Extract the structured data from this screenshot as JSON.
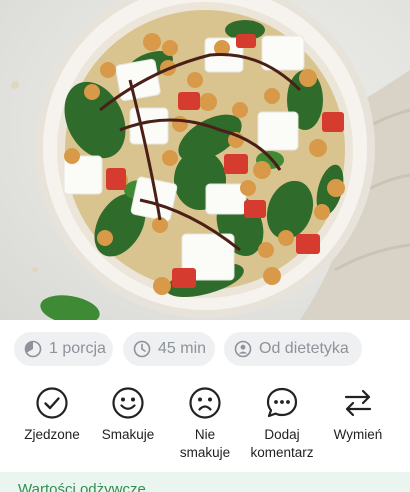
{
  "meta_chips": [
    {
      "icon": "pie-clock-icon",
      "label": "1 porcja"
    },
    {
      "icon": "clock-icon",
      "label": "45 min"
    },
    {
      "icon": "user-badge-icon",
      "label": "Od dietetyka"
    }
  ],
  "actions": [
    {
      "icon": "checkmark-circle-icon",
      "label_line1": "Zjedzone",
      "label_line2": ""
    },
    {
      "icon": "smile-face-icon",
      "label_line1": "Smakuje",
      "label_line2": ""
    },
    {
      "icon": "sad-face-icon",
      "label_line1": "Nie",
      "label_line2": "smakuje"
    },
    {
      "icon": "comment-icon",
      "label_line1": "Dodaj",
      "label_line2": "komentarz"
    },
    {
      "icon": "swap-arrows-icon",
      "label_line1": "Wymień",
      "label_line2": ""
    }
  ],
  "footer": {
    "title": "Wartości odżywcze"
  },
  "colors": {
    "accent_green": "#2f8f55",
    "chip_bg": "#eef0f2",
    "chip_text": "#8d9399"
  }
}
